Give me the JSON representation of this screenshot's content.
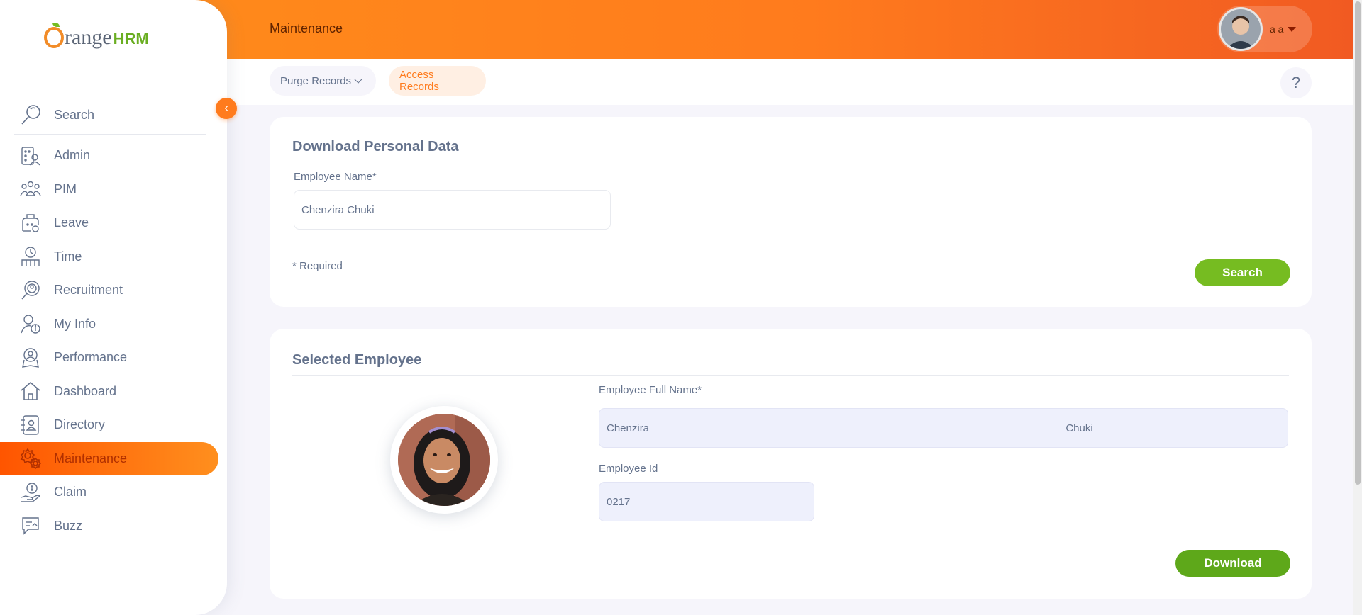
{
  "brand": {
    "word": "range",
    "hrm": "HRM"
  },
  "sidebar": {
    "search_placeholder": "Search",
    "items": [
      {
        "label": "Admin",
        "icon": "admin-icon"
      },
      {
        "label": "PIM",
        "icon": "pim-icon"
      },
      {
        "label": "Leave",
        "icon": "leave-icon"
      },
      {
        "label": "Time",
        "icon": "time-icon"
      },
      {
        "label": "Recruitment",
        "icon": "recruitment-icon"
      },
      {
        "label": "My Info",
        "icon": "my-info-icon"
      },
      {
        "label": "Performance",
        "icon": "performance-icon"
      },
      {
        "label": "Dashboard",
        "icon": "dashboard-icon"
      },
      {
        "label": "Directory",
        "icon": "directory-icon"
      },
      {
        "label": "Maintenance",
        "icon": "maintenance-icon",
        "active": true
      },
      {
        "label": "Claim",
        "icon": "claim-icon"
      },
      {
        "label": "Buzz",
        "icon": "buzz-icon"
      }
    ]
  },
  "header": {
    "title": "Maintenance",
    "user_name": "a a"
  },
  "subnav": {
    "purge_label": "Purge Records",
    "access_label": "Access Records",
    "help_label": "?"
  },
  "download_card": {
    "title": "Download Personal Data",
    "employee_name_label": "Employee Name*",
    "employee_name_value": "Chenzira  Chuki",
    "required_note": "* Required",
    "search_label": "Search"
  },
  "selected_card": {
    "title": "Selected Employee",
    "full_name_label": "Employee Full Name*",
    "first_name": "Chenzira",
    "middle_name": "",
    "last_name": "Chuki",
    "employee_id_label": "Employee Id",
    "employee_id": "0217",
    "download_label": "Download"
  },
  "colors": {
    "accent": "#ff7b1d",
    "green": "#76bc21",
    "text": "#64728c",
    "background": "#f6f5fb"
  }
}
